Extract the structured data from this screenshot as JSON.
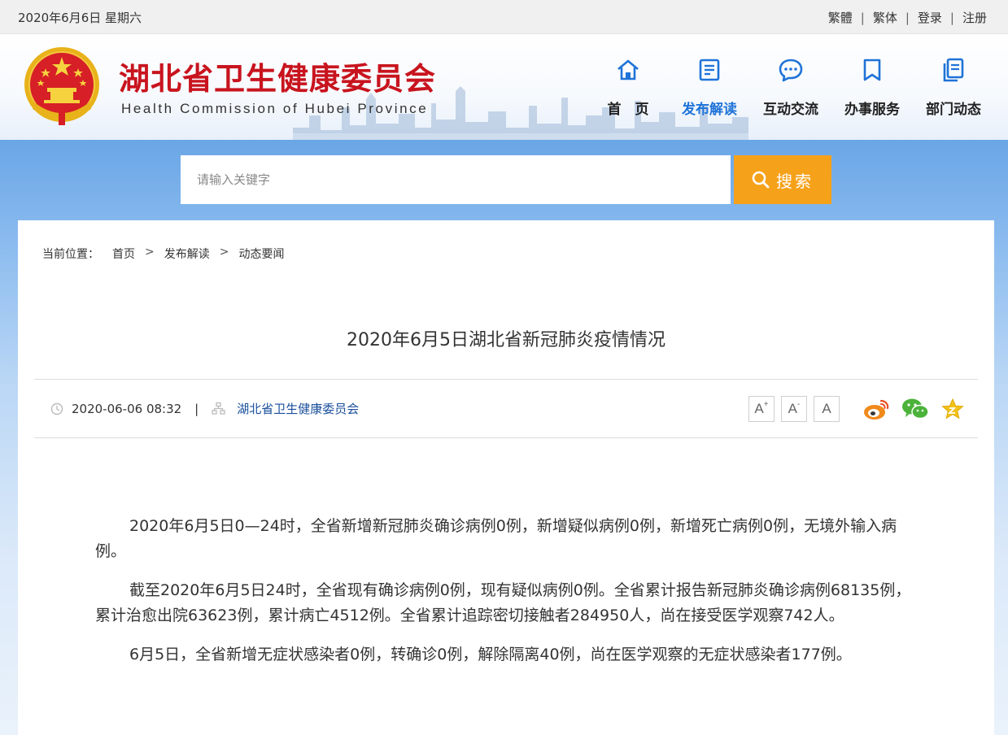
{
  "topbar": {
    "date": "2020年6月6日 星期六",
    "links": [
      "繁體",
      "繁体",
      "登录",
      "注册"
    ],
    "separator": "|"
  },
  "header": {
    "title": "湖北省卫生健康委员会",
    "subtitle": "Health Commission of Hubei Province",
    "brand_color": "#c8141e"
  },
  "nav": {
    "items": [
      {
        "label": "首　页",
        "icon": "home-icon"
      },
      {
        "label": "发布解读",
        "icon": "document-icon",
        "active": true
      },
      {
        "label": "互动交流",
        "icon": "chat-bubble-icon"
      },
      {
        "label": "办事服务",
        "icon": "bookmark-icon"
      },
      {
        "label": "部门动态",
        "icon": "files-icon"
      }
    ],
    "active_color": "#1f73d8"
  },
  "search": {
    "placeholder": "请输入关键字",
    "button_label": "搜索",
    "button_color": "#f6a11a"
  },
  "breadcrumb": {
    "prefix": "当前位置：",
    "items": [
      "首页",
      "发布解读",
      "动态要闻"
    ],
    "arrow": ">"
  },
  "article": {
    "title": "2020年6月5日湖北省新冠肺炎疫情情况",
    "datetime": "2020-06-06 08:32",
    "meta_separator": "|",
    "source": "湖北省卫生健康委员会",
    "paragraphs": [
      "2020年6月5日0—24时，全省新增新冠肺炎确诊病例0例，新增疑似病例0例，新增死亡病例0例，无境外输入病例。",
      "截至2020年6月5日24时，全省现有确诊病例0例，现有疑似病例0例。全省累计报告新冠肺炎确诊病例68135例，累计治愈出院63623例，累计病亡4512例。全省累计追踪密切接触者284950人，尚在接受医学观察742人。",
      "6月5日，全省新增无症状感染者0例，转确诊0例，解除隔离40例，尚在医学观察的无症状感染者177例。"
    ]
  },
  "tools": {
    "font_larger": "A",
    "font_larger_mark": "+",
    "font_smaller": "A",
    "font_smaller_mark": "-",
    "font_default": "A",
    "share_icons": [
      "weibo-icon",
      "wechat-icon",
      "favorite-star-icon"
    ]
  }
}
